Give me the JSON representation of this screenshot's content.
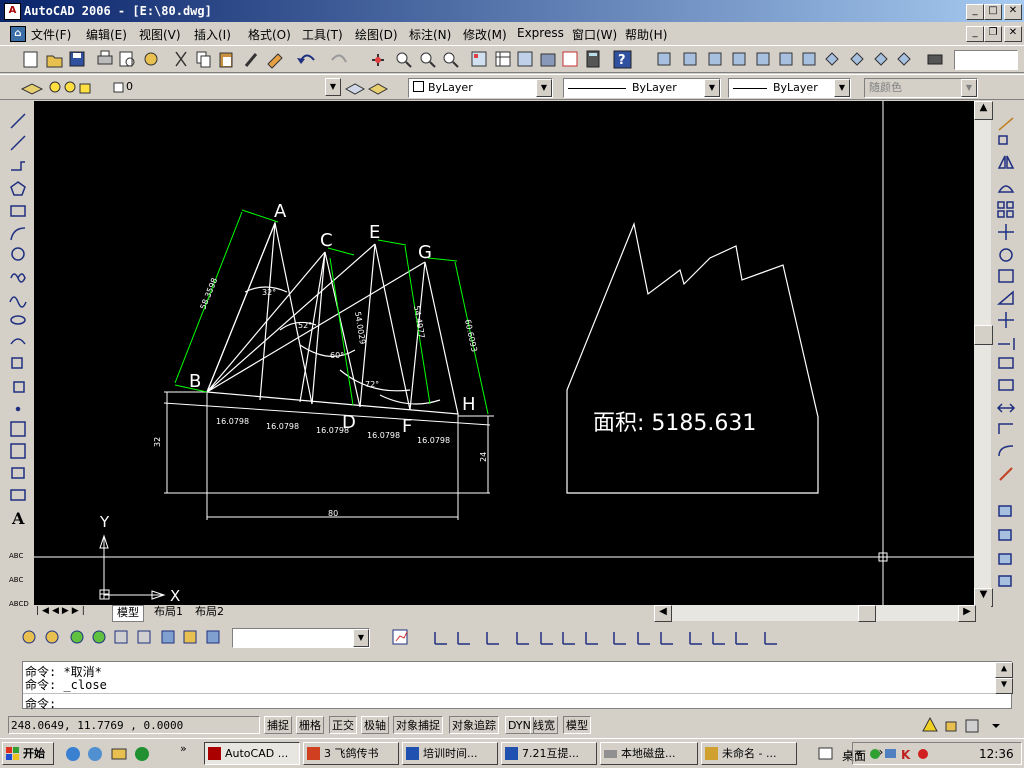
{
  "window": {
    "title": "AutoCAD 2006 - [E:\\80.dwg]"
  },
  "menu": [
    "文件(F)",
    "编辑(E)",
    "视图(V)",
    "插入(I)",
    "格式(O)",
    "工具(T)",
    "绘图(D)",
    "标注(N)",
    "修改(M)",
    "Express",
    "窗口(W)",
    "帮助(H)"
  ],
  "layers": {
    "current": "0",
    "color": "ByLayer",
    "linetype": "ByLayer",
    "lineweight": "ByLayer",
    "plotstyle": "随颜色"
  },
  "drawing": {
    "points": [
      "A",
      "B",
      "C",
      "D",
      "E",
      "F",
      "G",
      "H"
    ],
    "angles": [
      "32°",
      "52°",
      "60°",
      "72°"
    ],
    "dims_bottom": [
      "16.0798",
      "16.0798",
      "16.0798",
      "16.0798",
      "16.0798"
    ],
    "dims_slant": [
      "58.3598",
      "54.0029",
      "54.4977",
      "60.6093"
    ],
    "dim_left": "32",
    "dim_right": "24",
    "dim_total": "80",
    "area_text": "面积: 5185.631",
    "ucs_x": "X",
    "ucs_y": "Y"
  },
  "tabs": [
    "模型",
    "布局1",
    "布局2"
  ],
  "command": {
    "line1": "命令: *取消*",
    "line2": "命令: _close",
    "prompt": "命令:"
  },
  "status": {
    "coords": "248.0649, 11.7769 , 0.0000",
    "buttons": [
      {
        "label": "捕捉",
        "on": false
      },
      {
        "label": "栅格",
        "on": false
      },
      {
        "label": "正交",
        "on": true
      },
      {
        "label": "极轴",
        "on": false
      },
      {
        "label": "对象捕捉",
        "on": true
      },
      {
        "label": "对象追踪",
        "on": true
      },
      {
        "label": "DYN",
        "on": false
      },
      {
        "label": "线宽",
        "on": false
      },
      {
        "label": "模型",
        "on": true
      }
    ]
  },
  "taskbar": {
    "start": "开始",
    "tasks": [
      "AutoCAD ...",
      "3 飞鸽传书",
      "培训时间...",
      "7.21互提...",
      "本地磁盘...",
      "未命名 - ..."
    ],
    "desktop": "桌面",
    "clock": "12:36"
  }
}
